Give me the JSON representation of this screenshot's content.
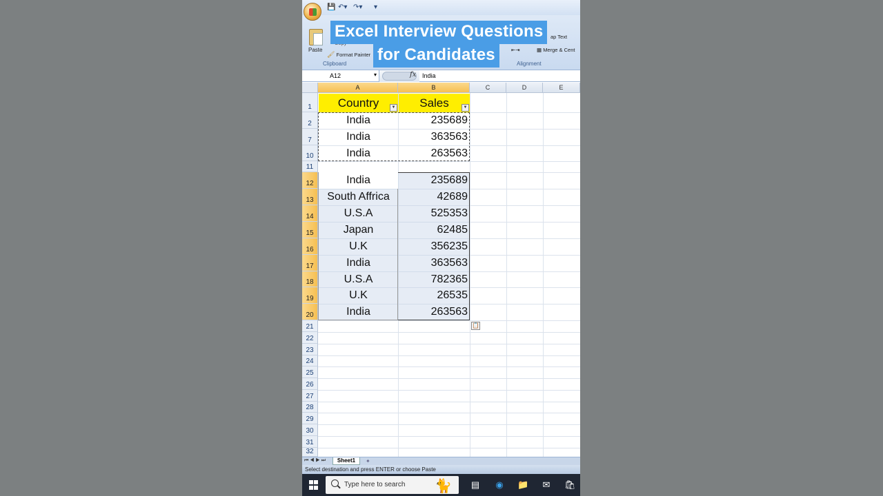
{
  "overlay": {
    "title_line1": "Excel Interview Questions",
    "title_line2": "for Candidates"
  },
  "ribbon": {
    "paste": "Paste",
    "copy": "Copy",
    "format_painter": "Format Painter",
    "clipboard_group": "Clipboard",
    "wrap_text": "ap Text",
    "merge_center": "Merge & Cent",
    "alignment_group": "Alignment"
  },
  "formula_bar": {
    "name_box": "A12",
    "fx": "fx",
    "value": "India"
  },
  "columns": [
    "A",
    "B",
    "C",
    "D",
    "E"
  ],
  "table_header": {
    "country": "Country",
    "sales": "Sales"
  },
  "row_numbers": [
    "1",
    "2",
    "7",
    "10",
    "11",
    "12",
    "13",
    "14",
    "15",
    "16",
    "17",
    "18",
    "19",
    "20",
    "21",
    "22",
    "23",
    "24",
    "25",
    "26",
    "27",
    "28",
    "29",
    "30",
    "31",
    "32"
  ],
  "filtered_rows": [
    {
      "country": "India",
      "sales": "235689"
    },
    {
      "country": "India",
      "sales": "363563"
    },
    {
      "country": "India",
      "sales": "263563"
    }
  ],
  "pasted_rows": [
    {
      "country": "India",
      "sales": "235689"
    },
    {
      "country": "South Affrica",
      "sales": "42689"
    },
    {
      "country": "U.S.A",
      "sales": "525353"
    },
    {
      "country": "Japan",
      "sales": "62485"
    },
    {
      "country": "U.K",
      "sales": "356235"
    },
    {
      "country": "India",
      "sales": "363563"
    },
    {
      "country": "U.S.A",
      "sales": "782365"
    },
    {
      "country": "U.K",
      "sales": "26535"
    },
    {
      "country": "India",
      "sales": "263563"
    }
  ],
  "sheet_tab": "Sheet1",
  "status": "Select destination and press ENTER or choose Paste",
  "taskbar": {
    "search_placeholder": "Type here to search"
  },
  "colors": {
    "header_yellow": "#ffee00",
    "selected_header": "#f6bf52",
    "overlay_blue": "#4a9de6",
    "taskbar": "#1f2633"
  }
}
